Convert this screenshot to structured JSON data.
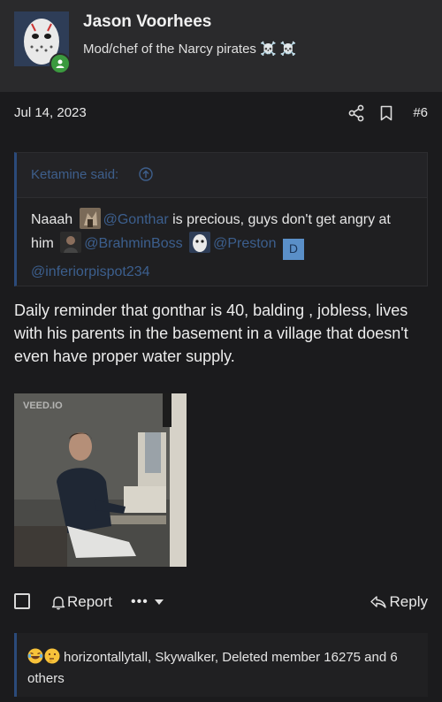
{
  "author": {
    "name": "Jason Voorhees",
    "title": "Mod/chef of the Narcy pirates ☠️ ☠️",
    "online": true
  },
  "post": {
    "date": "Jul 14, 2023",
    "number": "#6",
    "text": "Daily reminder that gonthar is 40, balding , jobless, lives with his parents in the basement in a village that doesn't even have proper water supply."
  },
  "quote": {
    "author_label": "Ketamine said:",
    "text_start": "Naaah",
    "mention_1": "@Gonthar",
    "text_mid": " is precious, guys don't get angry at him",
    "mention_2": "@BrahminBoss",
    "mention_3": "@Preston",
    "letter_avatar": "D",
    "mention_4": "@inferiorpispot234"
  },
  "attachment": {
    "watermark": "VEED.IO"
  },
  "actions": {
    "report": "Report",
    "more": "•••",
    "reply": "Reply"
  },
  "reactions": {
    "text": "horizontallytall, Skywalker, Deleted member 16275 and 6 others"
  },
  "icons": {
    "share": "share-icon",
    "bookmark": "bookmark-icon",
    "bell": "bell-icon",
    "reply": "reply-arrow-icon",
    "quote_up": "arrow-up-circle-icon"
  },
  "colors": {
    "accent": "#3c5f8e",
    "online": "#3b9a3f"
  }
}
